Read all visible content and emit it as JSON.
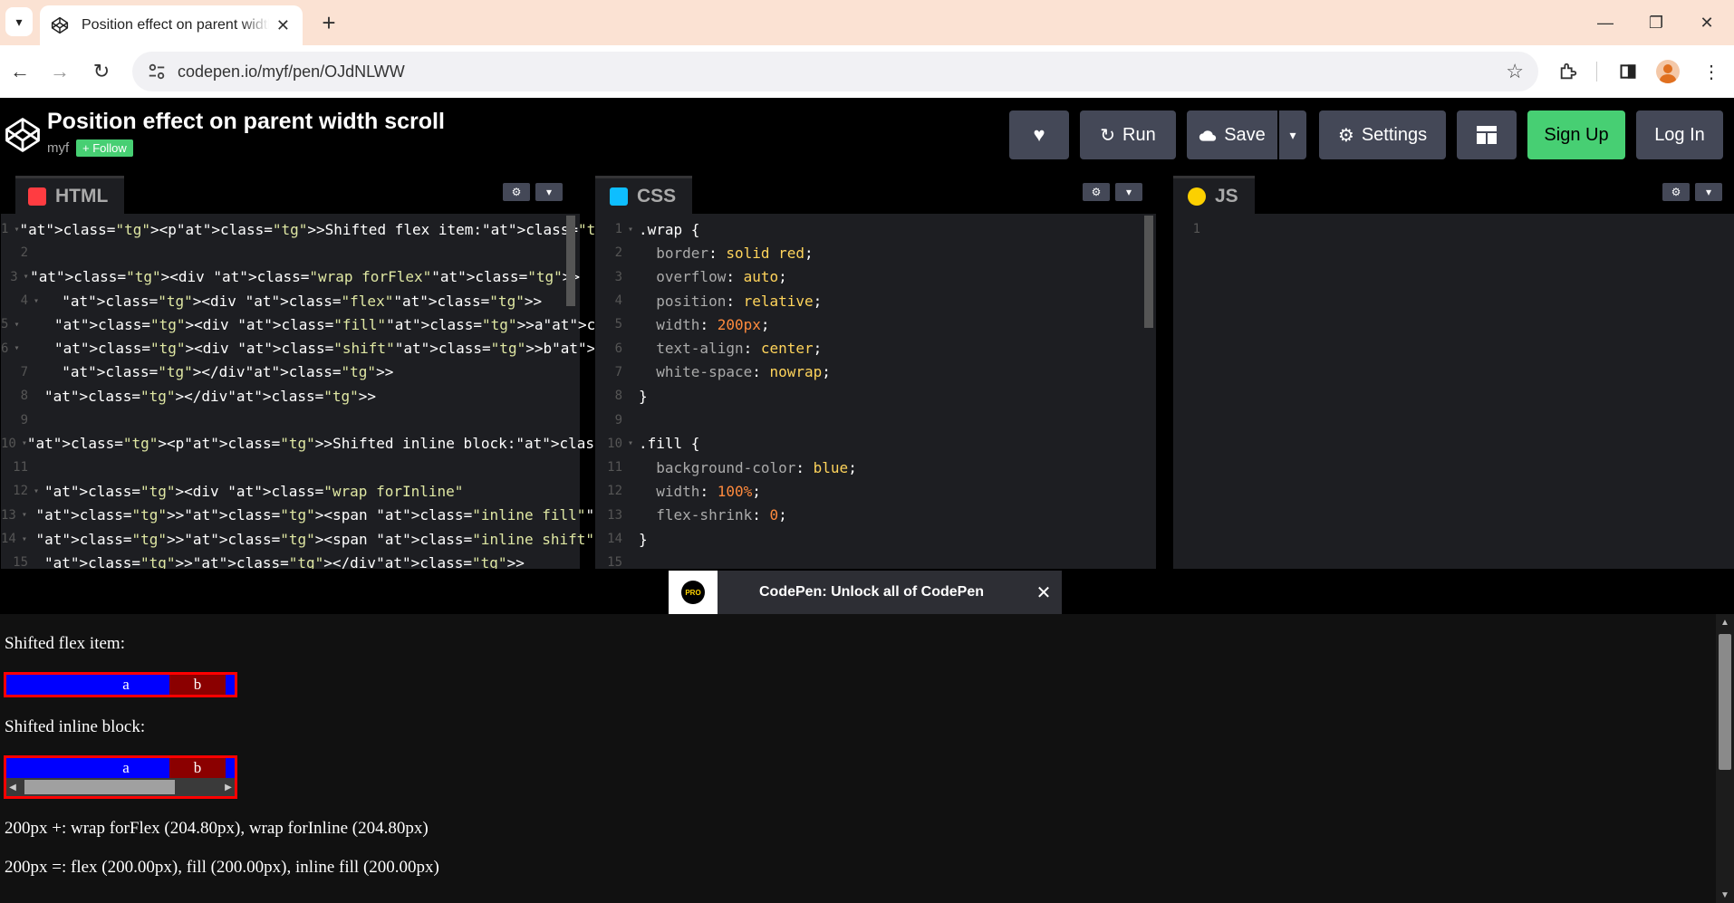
{
  "browser": {
    "tab_title": "Position effect on parent width scroll",
    "tab_close": "✕",
    "new_tab": "+",
    "url": "codepen.io/myf/pen/OJdNLWW",
    "window_controls": [
      "—",
      "❐",
      "✕"
    ]
  },
  "pen": {
    "title": "Position effect on parent width scroll",
    "author": "myf",
    "follow_label": "+ Follow"
  },
  "header_buttons": {
    "run": "Run",
    "save": "Save",
    "settings": "Settings",
    "signup": "Sign Up",
    "login": "Log In"
  },
  "editors": {
    "html": {
      "label": "HTML",
      "color": "#ff3c41"
    },
    "css": {
      "label": "CSS",
      "color": "#0ebeff"
    },
    "js": {
      "label": "JS",
      "color": "#fcd000"
    }
  },
  "html_code": [
    {
      "n": "1",
      "f": "▾",
      "t": "<p>Shifted flex item:</p>"
    },
    {
      "n": "2",
      "f": "",
      "t": ""
    },
    {
      "n": "3",
      "f": "▾",
      "t": "<div class=\"wrap forFlex\">"
    },
    {
      "n": "4",
      "f": "▾",
      "t": "  <div class=\"flex\">"
    },
    {
      "n": "5",
      "f": "▾",
      "t": "    <div class=\"fill\">a</div>"
    },
    {
      "n": "6",
      "f": "▾",
      "t": "    <div class=\"shift\">b</div>"
    },
    {
      "n": "7",
      "f": "",
      "t": "  </div>"
    },
    {
      "n": "8",
      "f": "",
      "t": "</div>"
    },
    {
      "n": "9",
      "f": "",
      "t": ""
    },
    {
      "n": "10",
      "f": "▾",
      "t": "<p>Shifted inline block:</p>"
    },
    {
      "n": "11",
      "f": "",
      "t": ""
    },
    {
      "n": "12",
      "f": "▾",
      "t": "<div class=\"wrap forInline\""
    },
    {
      "n": "13",
      "f": "▾",
      "t": " ><span class=\"inline fill\">a</span"
    },
    {
      "n": "14",
      "f": "▾",
      "t": " ><span class=\"inline shift\">b</span"
    },
    {
      "n": "15",
      "f": "",
      "t": "></div>"
    }
  ],
  "css_code": [
    {
      "n": "1",
      "f": "▾",
      "t": ".wrap {"
    },
    {
      "n": "2",
      "f": "",
      "t": "  border: solid red;"
    },
    {
      "n": "3",
      "f": "",
      "t": "  overflow: auto;"
    },
    {
      "n": "4",
      "f": "",
      "t": "  position: relative;"
    },
    {
      "n": "5",
      "f": "",
      "t": "  width: 200px;"
    },
    {
      "n": "6",
      "f": "",
      "t": "  text-align: center;"
    },
    {
      "n": "7",
      "f": "",
      "t": "  white-space: nowrap;"
    },
    {
      "n": "8",
      "f": "",
      "t": "}"
    },
    {
      "n": "9",
      "f": "",
      "t": ""
    },
    {
      "n": "10",
      "f": "▾",
      "t": ".fill {"
    },
    {
      "n": "11",
      "f": "",
      "t": "  background-color: blue;"
    },
    {
      "n": "12",
      "f": "",
      "t": "  width: 100%;"
    },
    {
      "n": "13",
      "f": "",
      "t": "  flex-shrink: 0;"
    },
    {
      "n": "14",
      "f": "",
      "t": "}"
    },
    {
      "n": "15",
      "f": "",
      "t": ""
    }
  ],
  "js_code": [
    {
      "n": "1",
      "f": "",
      "t": ""
    }
  ],
  "banner": {
    "badge": "PRO",
    "text": "CodePen: Unlock all of CodePen",
    "close": "✕"
  },
  "preview": {
    "p1": "Shifted flex item:",
    "p2": "Shifted inline block:",
    "fill_text": "a",
    "shift_text": "b",
    "result1": "200px +: wrap forFlex (204.80px), wrap forInline (204.80px)",
    "result2": "200px =: flex (200.00px), fill (200.00px), inline fill (200.00px)"
  }
}
